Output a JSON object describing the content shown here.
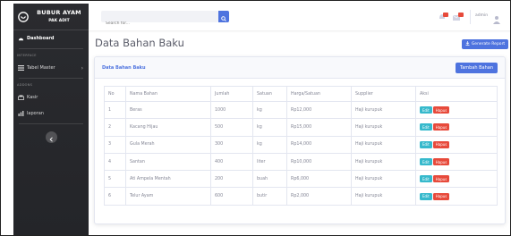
{
  "sidebar": {
    "brand_title": "BUBUR AYAM",
    "brand_subtitle": "PAK ADIT",
    "dashboard_label": "Dashboard",
    "heading_interface": "INTERFACE",
    "tabel_master_label": "Tabel Master",
    "heading_addons": "ADDONS",
    "kasir_label": "Kasir",
    "laporan_label": "laporan"
  },
  "topbar": {
    "search_placeholder": "Search for...",
    "user_name": "admin"
  },
  "page": {
    "title": "Data Bahan Baku",
    "generate_report_label": "Generate Report"
  },
  "card": {
    "title": "Data Bahan Baku",
    "add_button_label": "Tambah Bahan"
  },
  "table": {
    "headers": [
      "No",
      "Nama Bahan",
      "Jumlah",
      "Satuan",
      "Harga/Satuan",
      "Supplier",
      "Aksi"
    ],
    "edit_label": "Edit",
    "delete_label": "Hapus",
    "rows": [
      [
        "1",
        "Beras",
        "1000",
        "kg",
        "Rp12,000",
        "Haji kurupuk"
      ],
      [
        "2",
        "Kacang Hijau",
        "500",
        "kg",
        "Rp15,000",
        "Haji kurupuk"
      ],
      [
        "3",
        "Gula Merah",
        "300",
        "kg",
        "Rp14,000",
        "Haji kurupuk"
      ],
      [
        "4",
        "Santan",
        "400",
        "liter",
        "Rp10,000",
        "Haji kurupuk"
      ],
      [
        "5",
        "Ati Ampela Mentah",
        "200",
        "buah",
        "Rp6,000",
        "Haji kurupuk"
      ],
      [
        "6",
        "Telur Ayam",
        "600",
        "butir",
        "Rp2,000",
        "Haji kurupuk"
      ]
    ]
  },
  "colors": {
    "primary": "#4e73df",
    "info": "#36b9cc",
    "danger": "#e74a3b",
    "sidebar_bg": "#2a2b2f"
  }
}
